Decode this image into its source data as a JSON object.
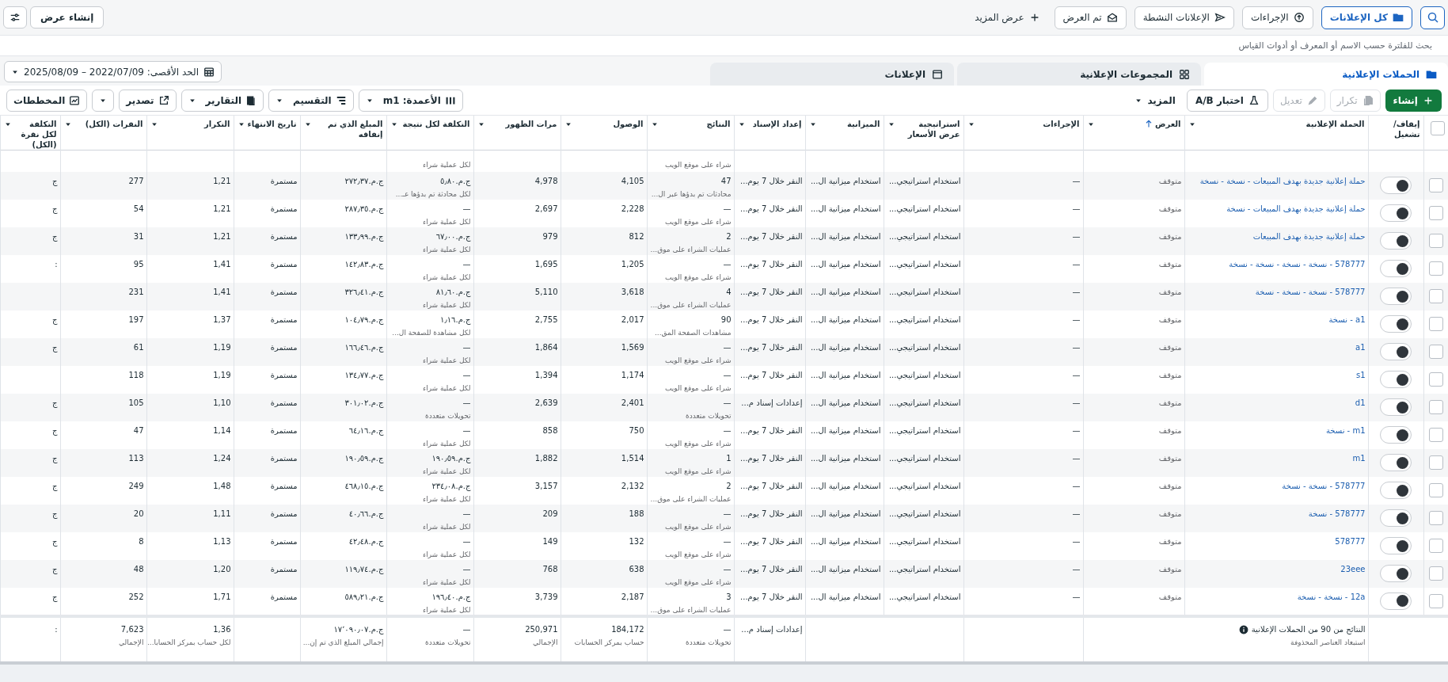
{
  "top_bar": {
    "filters": [
      {
        "label": "كل الإعلانات",
        "selected": true
      },
      {
        "label": "الإجراءات",
        "selected": false
      },
      {
        "label": "الإعلانات النشطة",
        "selected": false
      },
      {
        "label": "تم العرض",
        "selected": false
      }
    ],
    "more": "عرض المزيد",
    "create_view": "إنشاء عرض"
  },
  "search": {
    "placeholder": "بحث للفلترة حسب الاسم أو المعرف أو أدوات القياس"
  },
  "tabs": [
    {
      "label": "الحملات الإعلانية",
      "selected": true
    },
    {
      "label": "المجموعات الإعلانية",
      "selected": false
    },
    {
      "label": "الإعلانات",
      "selected": false
    }
  ],
  "date_range": {
    "label": "الحد الأقصى: 2022/07/09 – 2025/08/09"
  },
  "toolbar": {
    "actions": [
      {
        "kind": "primary",
        "label": "إنشاء",
        "disabled": false
      },
      {
        "kind": "button",
        "label": "تكرار",
        "disabled": true
      },
      {
        "kind": "button",
        "label": "تعديل",
        "disabled": true
      },
      {
        "kind": "outlined",
        "label": "اختبار A/B",
        "disabled": false
      },
      {
        "kind": "menu",
        "label": "المزيد",
        "disabled": false
      }
    ],
    "view_tools": [
      {
        "kind": "menu",
        "label": "الأعمدة: m1"
      },
      {
        "kind": "menu",
        "label": "التقسيم"
      },
      {
        "kind": "menu",
        "label": "التقارير"
      },
      {
        "kind": "button",
        "label": "تصدير"
      },
      {
        "kind": "caret"
      },
      {
        "kind": "button",
        "label": "المخططات"
      }
    ]
  },
  "table": {
    "columns": [
      {
        "kind": "checkbox",
        "checked": false
      },
      {
        "kind": "text",
        "label": "إيقاف/ تشغيل",
        "sorted": false
      },
      {
        "kind": "text",
        "label": "الحملة الإعلانية",
        "sorted": false
      },
      {
        "kind": "text",
        "label": "العرض",
        "sorted": true
      },
      {
        "kind": "text",
        "label": "الإجراءات",
        "sorted": false
      },
      {
        "kind": "text",
        "label": "استراتيجية عرض الأسعار",
        "sorted": false
      },
      {
        "kind": "text",
        "label": "الميزانية",
        "sorted": false
      },
      {
        "kind": "text",
        "label": "إعداد الإسناد",
        "sorted": false
      },
      {
        "kind": "text",
        "label": "النتائج",
        "sorted": false
      },
      {
        "kind": "text",
        "label": "الوصول",
        "sorted": false
      },
      {
        "kind": "text",
        "label": "مرات الظهور",
        "sorted": false
      },
      {
        "kind": "text",
        "label": "التكلفة لكل نتيجة",
        "sorted": false
      },
      {
        "kind": "text",
        "label": "المبلغ الذي تم إنفاقه",
        "sorted": false
      },
      {
        "kind": "text",
        "label": "تاريخ الانتهاء",
        "sorted": false
      },
      {
        "kind": "text",
        "label": "التكرار",
        "sorted": false
      },
      {
        "kind": "text",
        "label": "النقرات (الكل)",
        "sorted": false
      },
      {
        "kind": "text",
        "label": "التكلفة لكل نقرة (الكل)",
        "sorted": false
      }
    ],
    "rows": [
      {
        "kind": "partial",
        "results_note": "شراء على موقع الويب",
        "cost_per_result_note": "لكل عملية شراء"
      },
      {
        "kind": "full",
        "checked": false,
        "on": true,
        "campaign": "حملة إعلانية جديدة بهدف المبيعات - نسخة - نسخة",
        "status": "متوقف",
        "actions": "—",
        "bid_strategy": "استخدام استراتيجي...",
        "budget": "استخدام ميزانية ال...",
        "attribution": "النقر خلال 7 يوم...",
        "results": "47",
        "results_note": "محادثات تم بدؤها عبر ال...",
        "reach": "4,105",
        "impressions": "4,978",
        "cost_per_result": "ج.م.٥٫٨٠",
        "cost_per_result_note": "لكل محادثة تم بدؤها عـ...",
        "amount_spent": "ج.م.٢٧٢٫٣٧",
        "end_date": "مستمرة",
        "frequency": "1,21",
        "clicks": "277",
        "column_17": "ج"
      },
      {
        "kind": "full",
        "checked": false,
        "on": true,
        "campaign": "حملة إعلانية جديدة بهدف المبيعات - نسخة",
        "status": "متوقف",
        "actions": "—",
        "bid_strategy": "استخدام استراتيجي...",
        "budget": "استخدام ميزانية ال...",
        "attribution": "النقر خلال 7 يوم...",
        "results": "—",
        "results_note": "شراء على موقع الويب",
        "reach": "2,228",
        "impressions": "2,697",
        "cost_per_result": "—",
        "cost_per_result_note": "لكل عملية شراء",
        "amount_spent": "ج.م.٢٨٧٫٣٥",
        "end_date": "مستمرة",
        "frequency": "1,21",
        "clicks": "54",
        "column_17": "ج"
      },
      {
        "kind": "full",
        "checked": false,
        "on": true,
        "campaign": "حملة إعلانية جديدة بهدف المبيعات",
        "status": "متوقف",
        "actions": "—",
        "bid_strategy": "استخدام استراتيجي...",
        "budget": "استخدام ميزانية ال...",
        "attribution": "النقر خلال 7 يوم...",
        "results": "2",
        "results_note": "عمليات الشراء على موق...",
        "reach": "812",
        "impressions": "979",
        "cost_per_result": "ج.م.٦٧٫٠٠",
        "cost_per_result_note": "لكل عملية شراء",
        "amount_spent": "ج.م.١٣٣٫٩٩",
        "end_date": "مستمرة",
        "frequency": "1,21",
        "clicks": "31",
        "column_17": "ج"
      },
      {
        "kind": "full",
        "checked": false,
        "on": true,
        "campaign": "578777 - نسخة - نسخة - نسخة - نسخة",
        "status": "متوقف",
        "actions": "—",
        "bid_strategy": "استخدام استراتيجي...",
        "budget": "استخدام ميزانية ال...",
        "attribution": "النقر خلال 7 يوم...",
        "results": "—",
        "results_note": "شراء على موقع الويب",
        "reach": "1,205",
        "impressions": "1,695",
        "cost_per_result": "—",
        "cost_per_result_note": "لكل عملية شراء",
        "amount_spent": "ج.م.١٤٢٫٨٣",
        "end_date": "مستمرة",
        "frequency": "1,41",
        "clicks": "95",
        "column_17": ":"
      },
      {
        "kind": "full",
        "checked": false,
        "on": true,
        "campaign": "578777 - نسخة - نسخة - نسخة",
        "status": "متوقف",
        "actions": "—",
        "bid_strategy": "استخدام استراتيجي...",
        "budget": "استخدام ميزانية ال...",
        "attribution": "النقر خلال 7 يوم...",
        "results": "4",
        "results_note": "عمليات الشراء على موق...",
        "reach": "3,618",
        "impressions": "5,110",
        "cost_per_result": "ج.م.٨١٫٦٠",
        "cost_per_result_note": "لكل عملية شراء",
        "amount_spent": "ج.م.٣٢٦٫٤١",
        "end_date": "مستمرة",
        "frequency": "1,41",
        "clicks": "231"
      },
      {
        "kind": "full",
        "checked": false,
        "on": true,
        "campaign": "a1 - نسخة",
        "status": "متوقف",
        "actions": "—",
        "bid_strategy": "استخدام استراتيجي...",
        "budget": "استخدام ميزانية ال...",
        "attribution": "النقر خلال 7 يوم...",
        "results": "90",
        "results_note": "مشاهدات الصفحة المق...",
        "reach": "2,017",
        "impressions": "2,755",
        "cost_per_result": "ج.م.١٫١٦",
        "cost_per_result_note": "لكل مشاهدة للصفحة ال...",
        "amount_spent": "ج.م.١٠٤٫٧٩",
        "end_date": "مستمرة",
        "frequency": "1,37",
        "clicks": "197",
        "column_17": "ج"
      },
      {
        "kind": "full",
        "checked": false,
        "on": true,
        "campaign": "a1",
        "status": "متوقف",
        "actions": "—",
        "bid_strategy": "استخدام استراتيجي...",
        "budget": "استخدام ميزانية ال...",
        "attribution": "النقر خلال 7 يوم...",
        "results": "—",
        "results_note": "شراء على موقع الويب",
        "reach": "1,569",
        "impressions": "1,864",
        "cost_per_result": "—",
        "cost_per_result_note": "لكل عملية شراء",
        "amount_spent": "ج.م.١٦٦٫٤٦",
        "end_date": "مستمرة",
        "frequency": "1,19",
        "clicks": "61",
        "column_17": "ج"
      },
      {
        "kind": "full",
        "checked": false,
        "on": true,
        "campaign": "s1",
        "status": "متوقف",
        "actions": "—",
        "bid_strategy": "استخدام استراتيجي...",
        "budget": "استخدام ميزانية ال...",
        "attribution": "النقر خلال 7 يوم...",
        "results": "—",
        "results_note": "شراء على موقع الويب",
        "reach": "1,174",
        "impressions": "1,394",
        "cost_per_result": "—",
        "cost_per_result_note": "لكل عملية شراء",
        "amount_spent": "ج.م.١٣٤٫٧٧",
        "end_date": "مستمرة",
        "frequency": "1,19",
        "clicks": "118"
      },
      {
        "kind": "full",
        "checked": false,
        "on": true,
        "campaign": "d1",
        "status": "متوقف",
        "actions": "—",
        "bid_strategy": "استخدام استراتيجي...",
        "budget": "استخدام ميزانية ال...",
        "attribution": "إعدادات إسناد م...",
        "results": "—",
        "results_note": "تحويلات متعددة",
        "reach": "2,401",
        "impressions": "2,639",
        "cost_per_result": "—",
        "cost_per_result_note": "تحويلات متعددة",
        "amount_spent": "ج.م.٣٠١٫٠٢",
        "end_date": "مستمرة",
        "frequency": "1,10",
        "clicks": "105",
        "column_17": "ج"
      },
      {
        "kind": "full",
        "checked": false,
        "on": true,
        "campaign": "m1 - نسخة",
        "status": "متوقف",
        "actions": "—",
        "bid_strategy": "استخدام استراتيجي...",
        "budget": "استخدام ميزانية ال...",
        "attribution": "النقر خلال 7 يوم...",
        "results": "—",
        "results_note": "شراء على موقع الويب",
        "reach": "750",
        "impressions": "858",
        "cost_per_result": "—",
        "cost_per_result_note": "لكل عملية شراء",
        "amount_spent": "ج.م.٦٤٫١٦",
        "end_date": "مستمرة",
        "frequency": "1,14",
        "clicks": "47",
        "column_17": "ج"
      },
      {
        "kind": "full",
        "checked": false,
        "on": true,
        "campaign": "m1",
        "status": "متوقف",
        "actions": "—",
        "bid_strategy": "استخدام استراتيجي...",
        "budget": "استخدام ميزانية ال...",
        "attribution": "النقر خلال 7 يوم...",
        "results": "1",
        "results_note": "شراء على موقع الويب",
        "reach": "1,514",
        "impressions": "1,882",
        "cost_per_result": "ج.م.١٩٠٫٥٩",
        "cost_per_result_note": "لكل عملية شراء",
        "amount_spent": "ج.م.١٩٠٫٥٩",
        "end_date": "مستمرة",
        "frequency": "1,24",
        "clicks": "113",
        "column_17": "ج"
      },
      {
        "kind": "full",
        "checked": false,
        "on": true,
        "campaign": "578777 - نسخة - نسخة",
        "status": "متوقف",
        "actions": "—",
        "bid_strategy": "استخدام استراتيجي...",
        "budget": "استخدام ميزانية ال...",
        "attribution": "النقر خلال 7 يوم...",
        "results": "2",
        "results_note": "عمليات الشراء على موق...",
        "reach": "2,132",
        "impressions": "3,157",
        "cost_per_result": "ج.م.٢٣٤٫٠٨",
        "cost_per_result_note": "لكل عملية شراء",
        "amount_spent": "ج.م.٤٦٨٫١٥",
        "end_date": "مستمرة",
        "frequency": "1,48",
        "clicks": "249",
        "column_17": "ج"
      },
      {
        "kind": "full",
        "checked": false,
        "on": true,
        "campaign": "578777 - نسخة",
        "status": "متوقف",
        "actions": "—",
        "bid_strategy": "استخدام استراتيجي...",
        "budget": "استخدام ميزانية ال...",
        "attribution": "النقر خلال 7 يوم...",
        "results": "—",
        "results_note": "شراء على موقع الويب",
        "reach": "188",
        "impressions": "209",
        "cost_per_result": "—",
        "cost_per_result_note": "لكل عملية شراء",
        "amount_spent": "ج.م.٤٠٫٦٦",
        "end_date": "مستمرة",
        "frequency": "1,11",
        "clicks": "20",
        "column_17": "ج"
      },
      {
        "kind": "full",
        "checked": false,
        "on": true,
        "campaign": "578777",
        "status": "متوقف",
        "actions": "—",
        "bid_strategy": "استخدام استراتيجي...",
        "budget": "استخدام ميزانية ال...",
        "attribution": "النقر خلال 7 يوم...",
        "results": "—",
        "results_note": "شراء على موقع الويب",
        "reach": "132",
        "impressions": "149",
        "cost_per_result": "—",
        "cost_per_result_note": "لكل عملية شراء",
        "amount_spent": "ج.م.٤٢٫٤٨",
        "end_date": "مستمرة",
        "frequency": "1,13",
        "clicks": "8",
        "column_17": "ج"
      },
      {
        "kind": "full",
        "checked": false,
        "on": true,
        "campaign": "23eee",
        "status": "متوقف",
        "actions": "—",
        "bid_strategy": "استخدام استراتيجي...",
        "budget": "استخدام ميزانية ال...",
        "attribution": "النقر خلال 7 يوم...",
        "results": "—",
        "results_note": "شراء على موقع الويب",
        "reach": "638",
        "impressions": "768",
        "cost_per_result": "—",
        "cost_per_result_note": "لكل عملية شراء",
        "amount_spent": "ج.م.١١٩٫٧٤",
        "end_date": "مستمرة",
        "frequency": "1,20",
        "clicks": "48",
        "column_17": "ج"
      },
      {
        "kind": "full",
        "checked": false,
        "on": true,
        "campaign": "12a - نسخة - نسخة",
        "status": "متوقف",
        "actions": "—",
        "bid_strategy": "استخدام استراتيجي...",
        "budget": "استخدام ميزانية ال...",
        "attribution": "النقر خلال 7 يوم...",
        "results": "3",
        "results_note": "عمليات الشراء على موق...",
        "reach": "2,187",
        "impressions": "3,739",
        "cost_per_result": "ج.م.١٩٦٫٤٠",
        "cost_per_result_note": "لكل عملية شراء",
        "amount_spent": "ج.م.٥٨٩٫٢١",
        "end_date": "مستمرة",
        "frequency": "1,71",
        "clicks": "252",
        "column_17": "ج"
      }
    ],
    "footer": {
      "summary": "النتائج من 90 من الحملات الإعلانية",
      "summary_note": "استبعاد العناصر المحذوفة",
      "attribution": "إعدادات إسناد م...",
      "results": "—",
      "results_note": "تحويلات متعددة",
      "reach": "184,172",
      "reach_note": "حساب بمركز الحسابات",
      "impressions": "250,971",
      "impressions_note": "الإجمالي",
      "cost_per_result": "—",
      "cost_per_result_note": "تحويلات متعددة",
      "amount_spent": "ج.م.١٧٬٠٩٠٫٠٧",
      "amount_spent_note": "إجمالي المبلغ الذي تم إن...",
      "frequency": "1,36",
      "frequency_note": "لكل حساب بمركز الحسابا...",
      "clicks": "7,623",
      "clicks_note": "الإجمالي",
      "column_17": ":"
    }
  }
}
